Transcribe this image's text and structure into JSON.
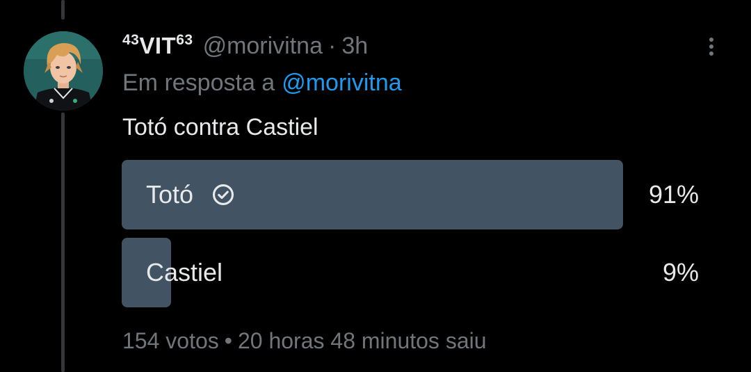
{
  "tweet": {
    "display_name_prefix": "43",
    "display_name_main": "VIT",
    "display_name_suffix": "63",
    "handle": "@morivitna",
    "separator": "·",
    "time": "3h",
    "reply_label": "Em resposta a",
    "reply_mention": "@morivitna",
    "text": "Totó contra Castiel"
  },
  "poll": {
    "options": [
      {
        "label": "Totó",
        "percent_label": "91%",
        "percent": 91,
        "winner": true
      },
      {
        "label": "Castiel",
        "percent_label": "9%",
        "percent": 9,
        "winner": false
      }
    ],
    "votes": "154 votos",
    "meta_separator": "•",
    "status": "20 horas 48 minutos saiu"
  },
  "icons": {
    "more": "more-options-icon",
    "check": "check-circle-icon",
    "avatar": "avatar"
  },
  "colors": {
    "background": "#000000",
    "text_primary": "#e7e9ea",
    "text_secondary": "#71767b",
    "link": "#1d9bf0",
    "poll_bar": "#425363",
    "thread_line": "#333639"
  }
}
